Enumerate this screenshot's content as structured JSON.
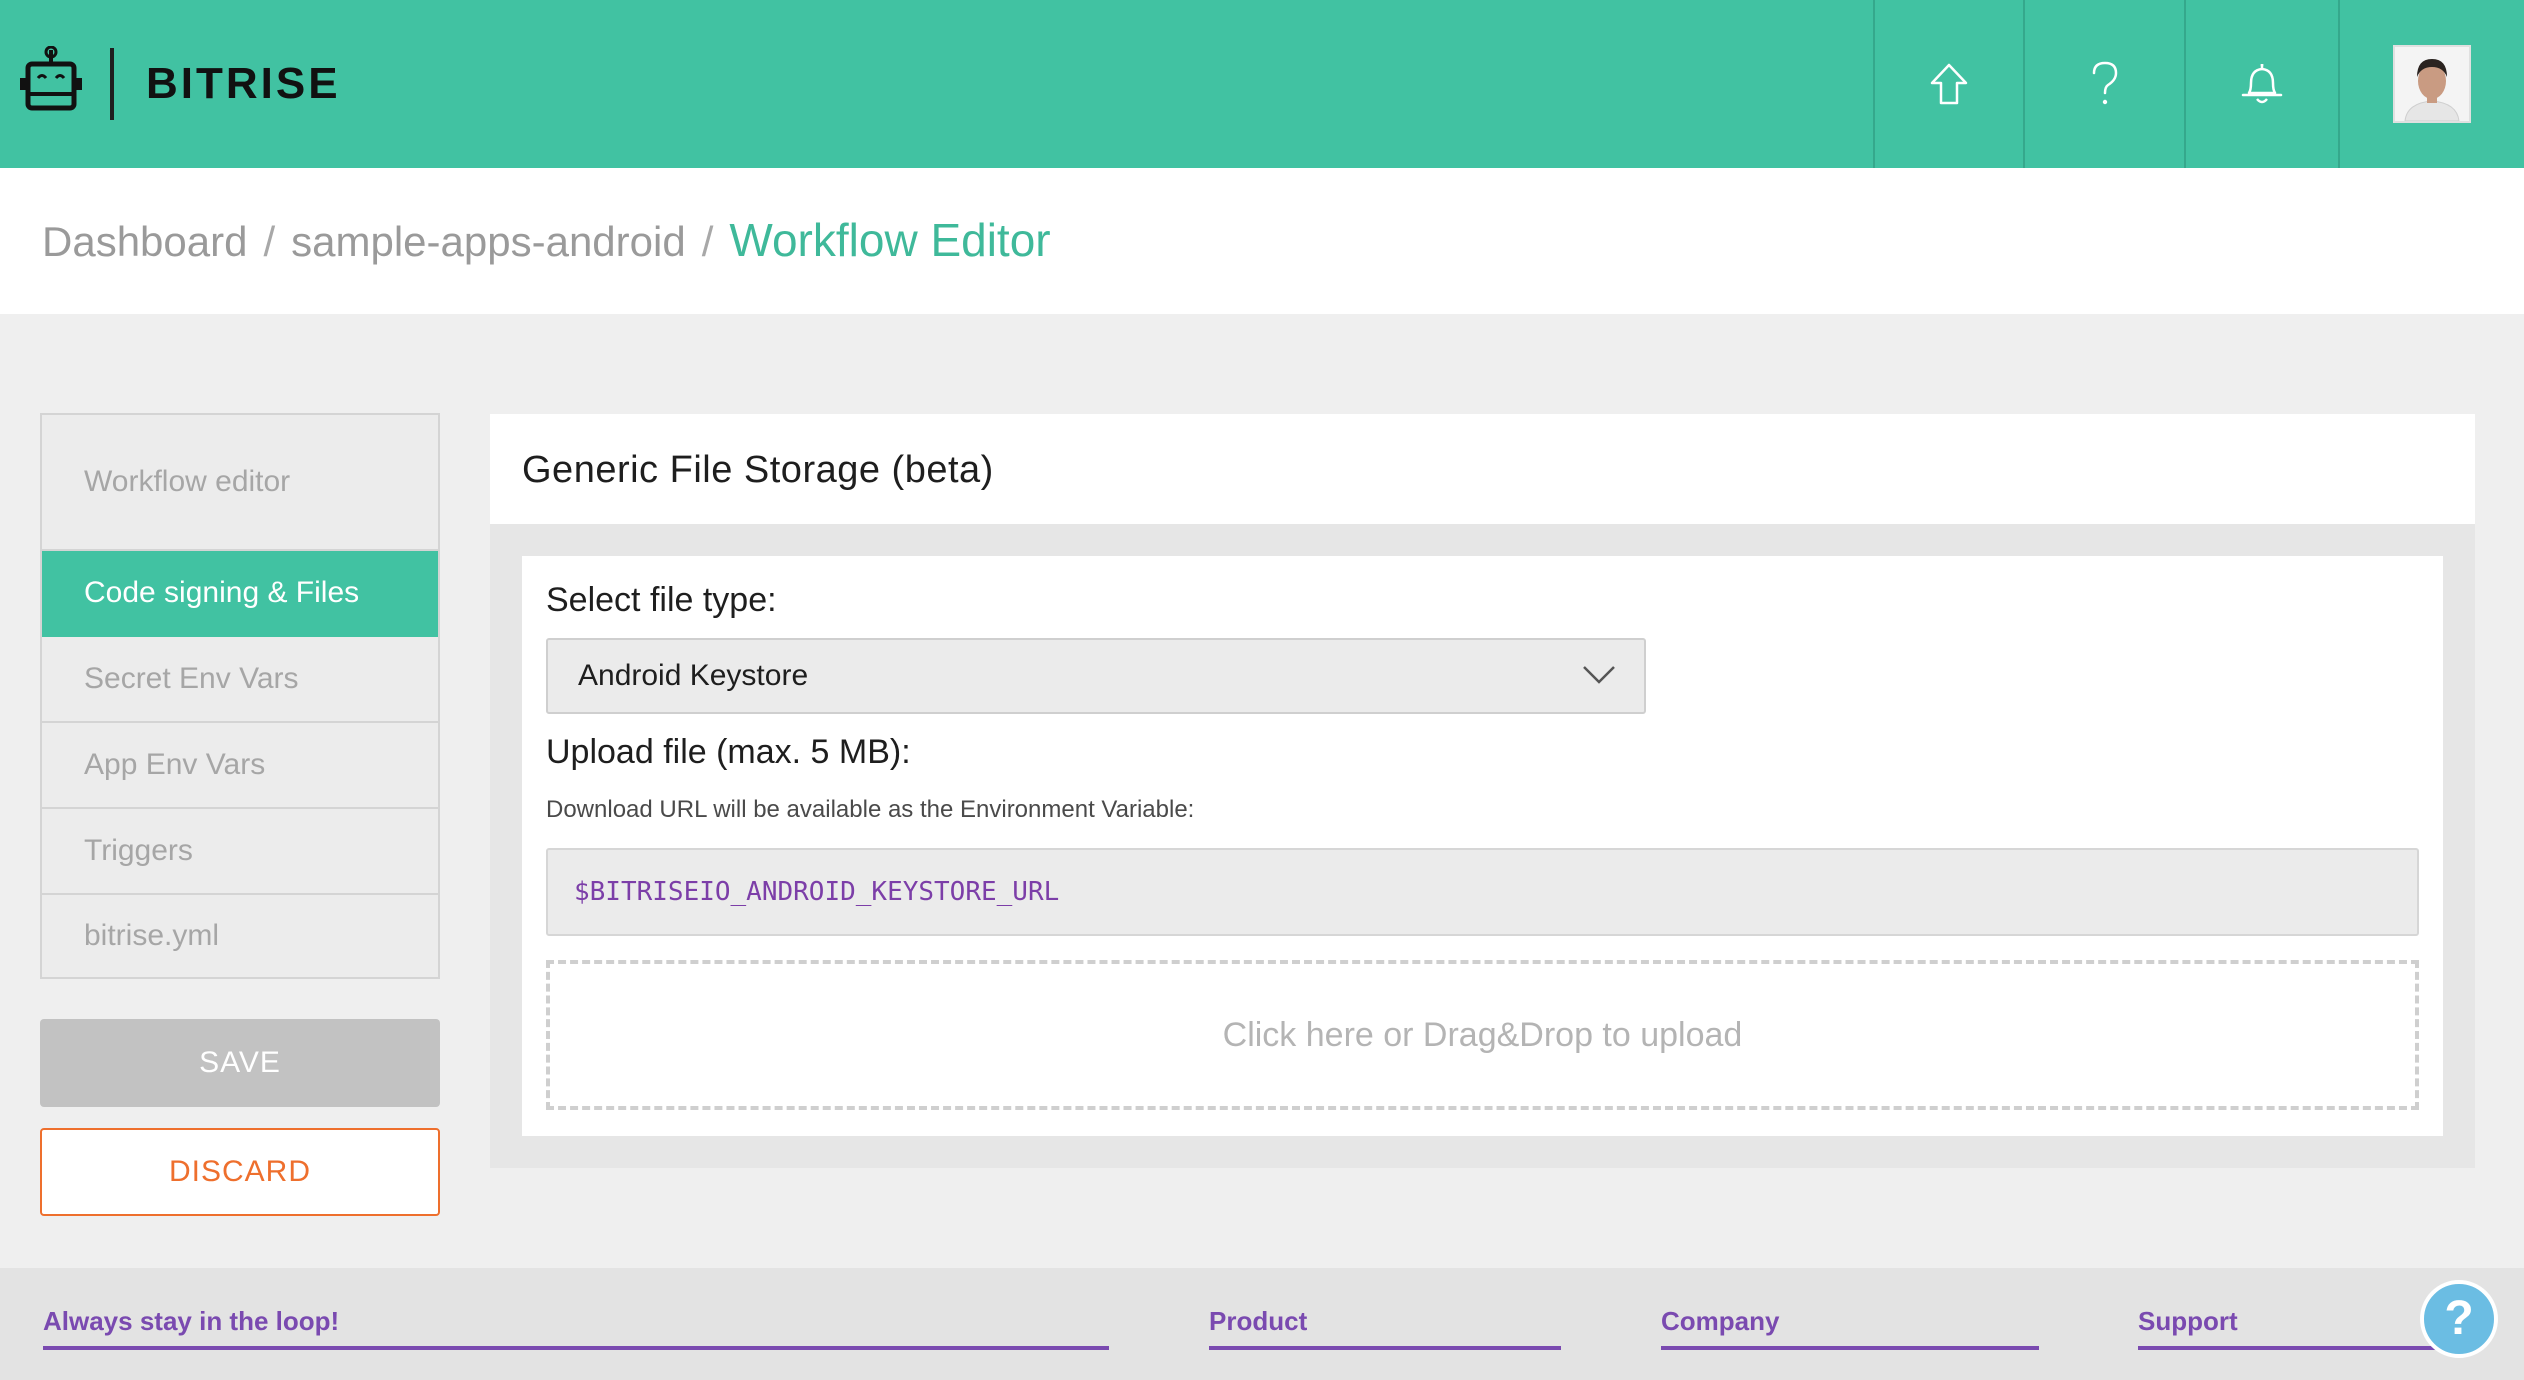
{
  "header": {
    "brand": "BITRISE",
    "nav_icons": [
      "home-icon",
      "question-icon",
      "bell-icon",
      "user-avatar"
    ]
  },
  "breadcrumb": {
    "items": [
      "Dashboard",
      "sample-apps-android"
    ],
    "separator": "/",
    "current": "Workflow Editor"
  },
  "sidebar": {
    "items": [
      {
        "label": "Workflow editor",
        "active": false
      },
      {
        "label": "Code signing & Files",
        "active": true
      },
      {
        "label": "Secret Env Vars",
        "active": false
      },
      {
        "label": "App Env Vars",
        "active": false
      },
      {
        "label": "Triggers",
        "active": false
      },
      {
        "label": "bitrise.yml",
        "active": false
      }
    ],
    "save_label": "SAVE",
    "discard_label": "DISCARD"
  },
  "main": {
    "title": "Generic File Storage (beta)",
    "file_type_label": "Select file type:",
    "file_type_selected": "Android Keystore",
    "upload_label": "Upload file (max. 5 MB):",
    "hint": "Download URL will be available as the Environment Variable:",
    "env_var": "$BITRISEIO_ANDROID_KEYSTORE_URL",
    "dropzone_text": "Click here or Drag&Drop to upload"
  },
  "footer": {
    "columns": [
      "Always stay in the loop!",
      "Product",
      "Company",
      "Support"
    ]
  },
  "help_bubble": "?",
  "colors": {
    "brand_green": "#41c2a2",
    "accent_purple": "#7a4ab0",
    "discard_orange": "#ee6f2d",
    "env_var_purple": "#7c3ea8"
  }
}
